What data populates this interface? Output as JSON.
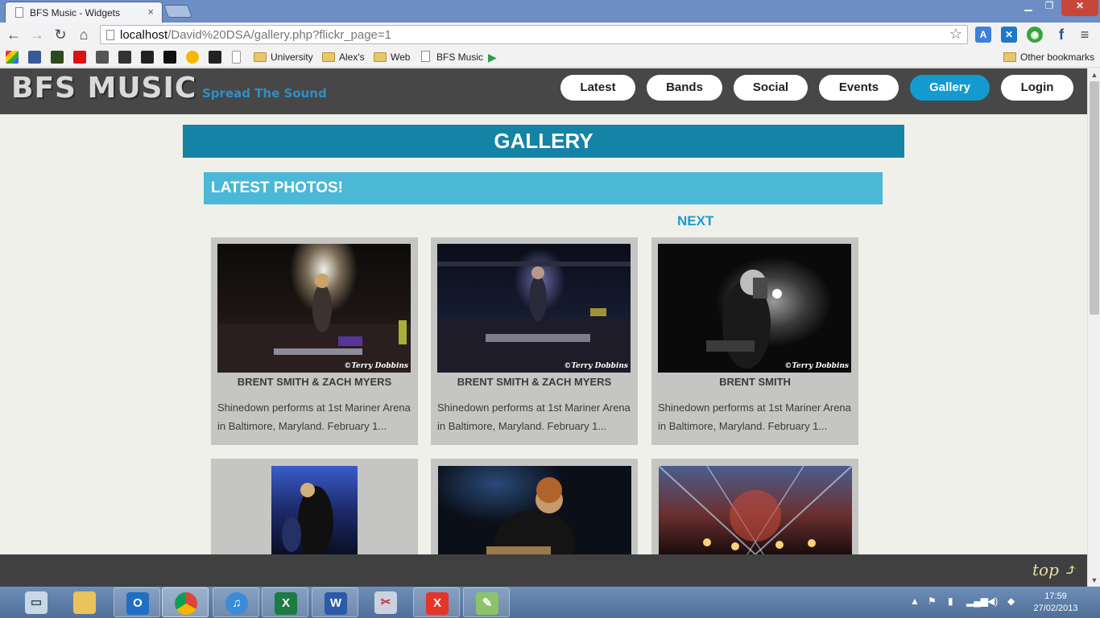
{
  "browser": {
    "tab_title": "BFS Music - Widgets",
    "close_glyph": "×",
    "window_controls": {
      "minimize": "▁",
      "maximize": "❐",
      "close": "✕"
    },
    "nav": {
      "back": "←",
      "forward": "→",
      "reload": "↻",
      "home": "⌂"
    },
    "url_host": "localhost",
    "url_path": "/David%20DSA/gallery.php?flickr_page=1",
    "bookmarks": [
      {
        "label": "University",
        "type": "folder"
      },
      {
        "label": "Alex's",
        "type": "folder"
      },
      {
        "label": "Web",
        "type": "folder"
      },
      {
        "label": "BFS Music",
        "type": "page"
      }
    ],
    "other_bookmarks": "Other bookmarks"
  },
  "site": {
    "logo": "BFS MUSIC",
    "tagline": "Spread The Sound",
    "nav": [
      {
        "label": "Latest",
        "active": false
      },
      {
        "label": "Bands",
        "active": false
      },
      {
        "label": "Social",
        "active": false
      },
      {
        "label": "Events",
        "active": false
      },
      {
        "label": "Gallery",
        "active": true
      },
      {
        "label": "Login",
        "active": false
      }
    ],
    "accent_color": "#139bcf"
  },
  "gallery": {
    "heading": "GALLERY",
    "section_heading": "LATEST PHOTOS!",
    "next_label": "NEXT",
    "watermark": "©Terry Dobbins",
    "photos": [
      {
        "title": "BRENT SMITH & ZACH MYERS",
        "description": "Shinedown performs at 1st Mariner Arena in Baltimore, Maryland. February 1..."
      },
      {
        "title": "BRENT SMITH & ZACH MYERS",
        "description": "Shinedown performs at 1st Mariner Arena in Baltimore, Maryland. February 1..."
      },
      {
        "title": "BRENT SMITH",
        "description": "Shinedown performs at 1st Mariner Arena in Baltimore, Maryland. February 1..."
      }
    ]
  },
  "footer": {
    "top_link": "top"
  },
  "taskbar": {
    "time": "17:59",
    "date": "27/02/2013",
    "apps": [
      "explorer",
      "outlook",
      "chrome",
      "itunes",
      "excel",
      "word",
      "snipping-tool",
      "xampp",
      "notepad"
    ]
  }
}
